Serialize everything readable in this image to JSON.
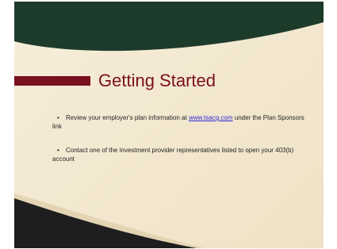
{
  "slide": {
    "title": "Getting Started",
    "bullets": [
      {
        "bullet_symbol": "•",
        "text_before_link": "Review your employer's plan information at ",
        "link_text": "www.tsacg.com",
        "text_after_link": " under the Plan Sponsors link"
      },
      {
        "bullet_symbol": "•",
        "text": "Contact one of the investment provider representatives listed to open your 403(b) account"
      }
    ]
  },
  "colors": {
    "accent": "#7a0f1f",
    "dark_green": "#1d3b2b",
    "background": "#f3e8d0",
    "link": "#2a2ad6"
  }
}
